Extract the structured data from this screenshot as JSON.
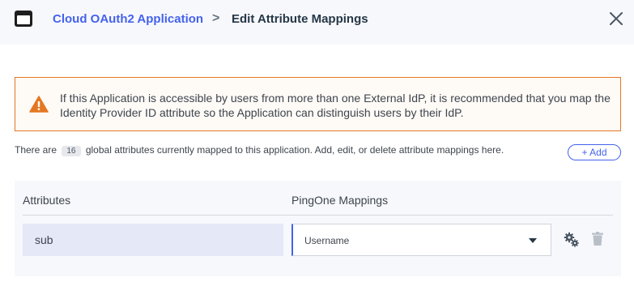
{
  "header": {
    "breadcrumb_link": "Cloud OAuth2 Application",
    "separator": ">",
    "current_page": "Edit Attribute Mappings"
  },
  "warning": {
    "message": "If this Application is accessible by users from more than one External IdP, it is recommended that you map the Identity Provider ID attribute so the Application can distinguish users by their IdP."
  },
  "info": {
    "prefix": "There are",
    "count": "16",
    "suffix": "global attributes currently mapped to this application. Add, edit, or delete attribute mappings here."
  },
  "actions": {
    "add_label": "+ Add"
  },
  "mappings": {
    "attributes_header": "Attributes",
    "pingone_header": "PingOne Mappings",
    "rows": [
      {
        "attribute": "sub",
        "mapping": "Username"
      }
    ]
  },
  "colors": {
    "accent": "#4462ed",
    "warning": "#e57722"
  }
}
